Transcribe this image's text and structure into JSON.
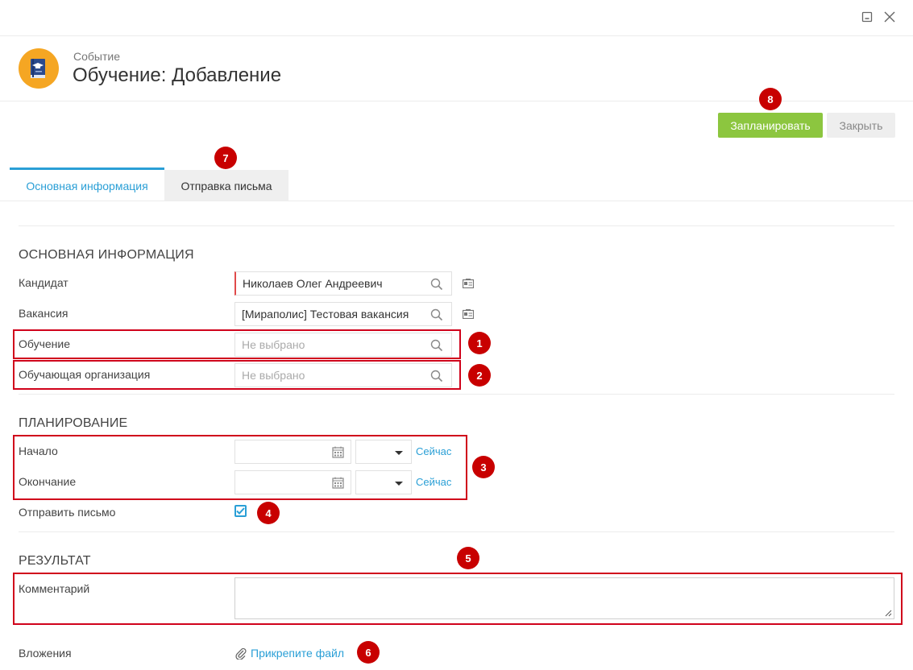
{
  "header": {
    "subtitle": "Событие",
    "title": "Обучение: Добавление",
    "icon": "book-graduation-icon",
    "icon_color": "#f5a623"
  },
  "toolbar": {
    "schedule_label": "Запланировать",
    "close_label": "Закрыть",
    "primary_color": "#8cc63f"
  },
  "tabs": [
    {
      "label": "Основная информация",
      "active": true
    },
    {
      "label": "Отправка письма",
      "active": false
    }
  ],
  "basic_info": {
    "section_title": "ОСНОВНАЯ ИНФОРМАЦИЯ",
    "candidate": {
      "label": "Кандидат",
      "value": "Николаев Олег Андреевич"
    },
    "vacancy": {
      "label": "Вакансия",
      "value": "[Мираполис] Тестовая вакансия"
    },
    "training": {
      "label": "Обучение",
      "placeholder": "Не выбрано"
    },
    "training_org": {
      "label": "Обучающая организация",
      "placeholder": "Не выбрано"
    }
  },
  "planning": {
    "section_title": "ПЛАНИРОВАНИЕ",
    "start": {
      "label": "Начало",
      "now_label": "Сейчас"
    },
    "end": {
      "label": "Окончание",
      "now_label": "Сейчас"
    },
    "send_letter": {
      "label": "Отправить письмо",
      "checked": true
    }
  },
  "result": {
    "section_title": "РЕЗУЛЬТАТ",
    "comment": {
      "label": "Комментарий",
      "value": ""
    },
    "attachments": {
      "label": "Вложения",
      "link_label": "Прикрепите файл"
    }
  },
  "annotations": {
    "color": "#c80000",
    "badges": [
      "1",
      "2",
      "3",
      "4",
      "5",
      "6",
      "7",
      "8"
    ]
  },
  "accent_color": "#2a9fd6"
}
